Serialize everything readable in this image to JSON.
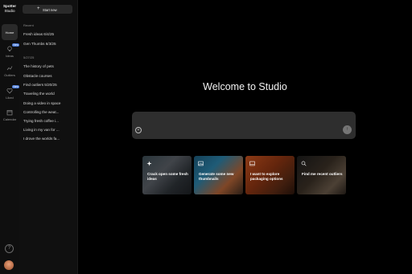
{
  "brand": {
    "line1": "Spotter",
    "line2": "Studio"
  },
  "rail": {
    "items": [
      {
        "label": "Home",
        "badge": ""
      },
      {
        "label": "Ideas",
        "badge": "New"
      },
      {
        "label": "Outliers",
        "badge": ""
      },
      {
        "label": "Liked",
        "badge": "New"
      },
      {
        "label": "Calendar",
        "badge": ""
      }
    ],
    "help": "?"
  },
  "sidebar": {
    "start_label": "Start new",
    "sections": [
      {
        "title": "Recent",
        "items": [
          "Fresh ideas 6/4/25",
          "Gen Thumbs 6/3/25"
        ]
      },
      {
        "title": "5/27/25",
        "items": [
          "The history of pets",
          "Obstacle courses",
          "Find outliers 5/20/25",
          "Traveling the world",
          "Doing a video in space",
          "Controlling the weat...",
          "Trying fresh coffee i...",
          "Living in my van for ...",
          "I drove the worlds fa..."
        ]
      }
    ]
  },
  "main": {
    "welcome": "Welcome to Studio",
    "prompt": {
      "placeholder": "",
      "add_icon": "+",
      "send_icon": "↑"
    },
    "cards": [
      {
        "text": "Crack open some fresh ideas",
        "icon": "sparkle-icon"
      },
      {
        "text": "Generate some new thumbnails",
        "icon": "image-icon"
      },
      {
        "text": "I want to explore packaging options",
        "icon": "layout-icon"
      },
      {
        "text": "Find me recent outliers",
        "icon": "search-icon"
      }
    ]
  },
  "colors": {
    "background": "#000000",
    "sidebar": "#101010",
    "prompt": "#2e2e2e",
    "badge": "#4a7bd8"
  }
}
